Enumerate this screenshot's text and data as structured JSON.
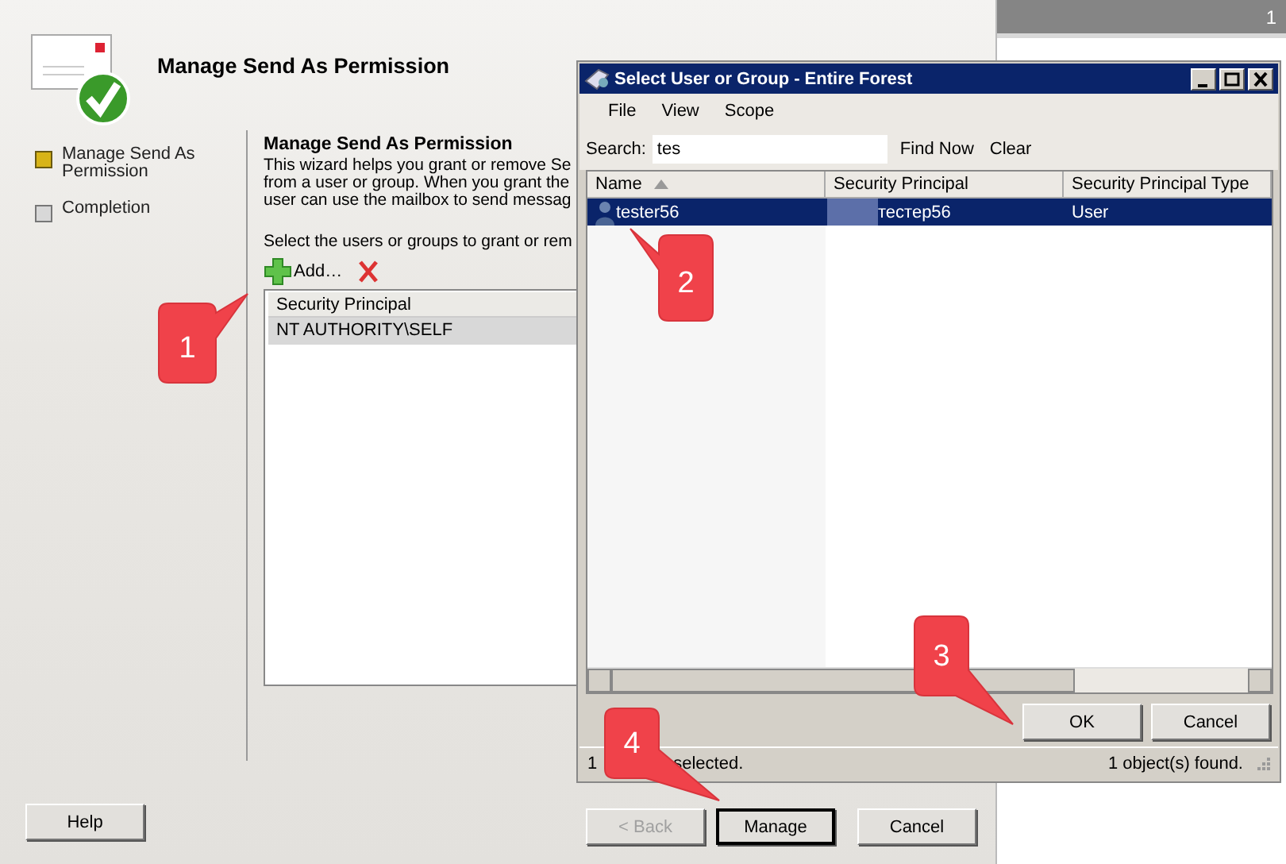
{
  "background_window": {
    "badge": "1"
  },
  "wizard": {
    "title": "Manage Send As Permission",
    "steps": [
      {
        "label": "Manage Send As Permission",
        "selected": true
      },
      {
        "label": "Completion",
        "selected": false
      }
    ],
    "page_heading": "Manage Send As Permission",
    "description": [
      "This wizard helps you grant or remove Se",
      "from a user or group. When you grant the",
      "user can use the mailbox to send messag"
    ],
    "instruction": "Select the users or groups to grant or rem",
    "add_label": "Add…",
    "table": {
      "columns": [
        "Security Principal"
      ],
      "rows": [
        {
          "cells": [
            "NT AUTHORITY\\SELF"
          ],
          "selected": true
        }
      ]
    },
    "help_button": "Help",
    "nav_buttons": [
      {
        "label": "< Back",
        "disabled": true,
        "default": false
      },
      {
        "label": "Manage",
        "disabled": false,
        "default": true
      },
      {
        "label": "Cancel",
        "disabled": false,
        "default": false
      }
    ]
  },
  "dialog": {
    "title": "Select User or Group - Entire Forest",
    "menu": [
      "File",
      "View",
      "Scope"
    ],
    "search": {
      "label": "Search:",
      "value": "tes"
    },
    "search_actions": [
      "Find Now",
      "Clear"
    ],
    "columns": [
      {
        "label": "Name",
        "sorted": true
      },
      {
        "label": "Security Principal",
        "sorted": false
      },
      {
        "label": "Security Principal Type",
        "sorted": false
      }
    ],
    "rows": [
      {
        "name": "tester56",
        "principal": "тестер56",
        "type": "User",
        "selected": true
      }
    ],
    "buttons": [
      "OK",
      "Cancel"
    ],
    "status_left": {
      "prefix": "1",
      "suffix": "selected."
    },
    "status_right": "1 object(s) found."
  },
  "callouts": [
    "1",
    "2",
    "3",
    "4"
  ]
}
